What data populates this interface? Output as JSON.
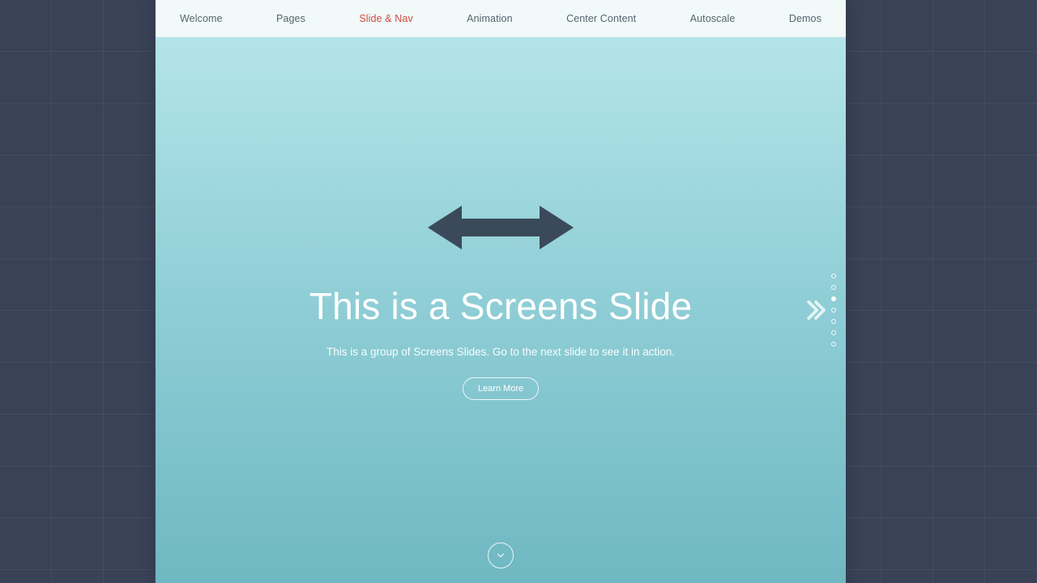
{
  "nav": {
    "items": [
      {
        "label": "Welcome",
        "active": false
      },
      {
        "label": "Pages",
        "active": false
      },
      {
        "label": "Slide & Nav",
        "active": true
      },
      {
        "label": "Animation",
        "active": false
      },
      {
        "label": "Center Content",
        "active": false
      },
      {
        "label": "Autoscale",
        "active": false
      },
      {
        "label": "Demos",
        "active": false
      }
    ]
  },
  "slide": {
    "title": "This is a Screens Slide",
    "subtitle": "This is a group of Screens Slides. Go to the next slide to see it in action.",
    "cta_label": "Learn More"
  },
  "pager": {
    "count": 7,
    "active_index": 2
  },
  "icons": {
    "double_arrow": "double-arrow-icon",
    "next": "chevrons-right-icon",
    "down": "chevron-down-icon"
  },
  "colors": {
    "accent": "#d24a43",
    "arrow_fill": "#3b4a5a",
    "slide_gradient_top": "#b4e4ea",
    "slide_gradient_bottom": "#6fb8c2",
    "page_bg": "#3a4258"
  }
}
